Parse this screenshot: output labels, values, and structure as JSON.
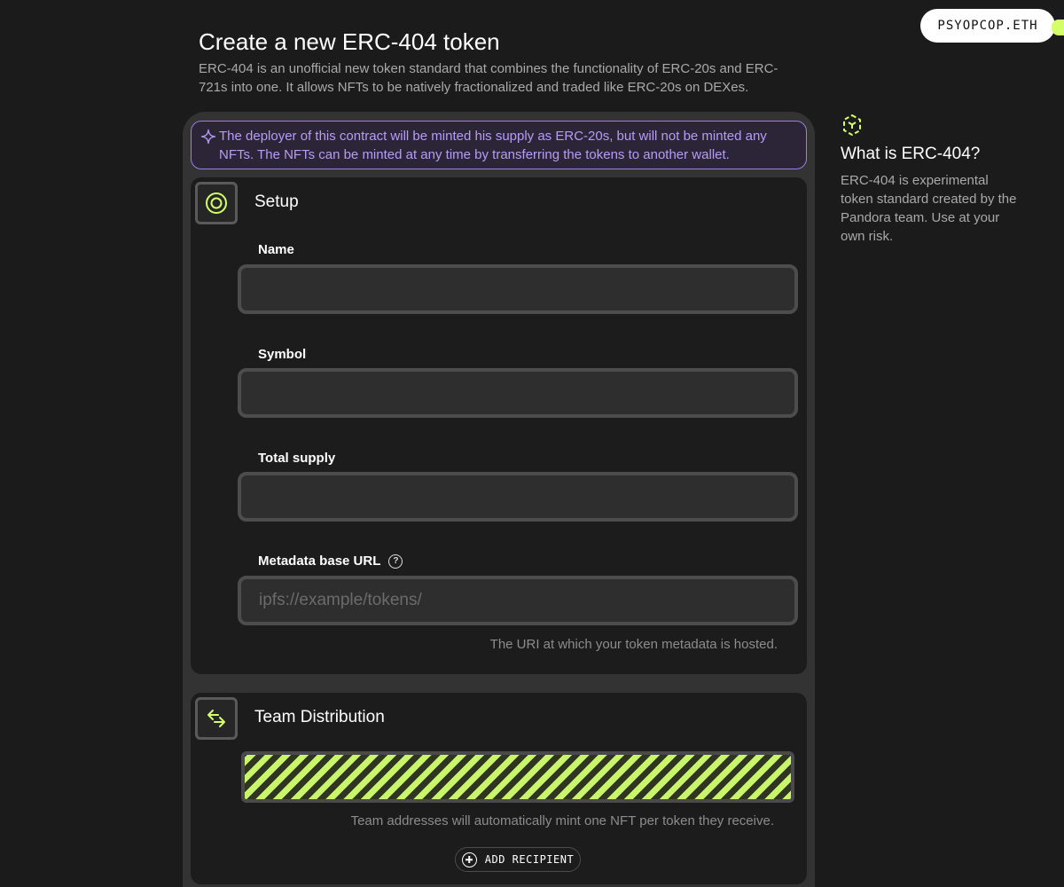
{
  "wallet": {
    "label": "PSYOPCOP.ETH"
  },
  "header": {
    "title": "Create a new ERC-404 token",
    "description": "ERC-404 is an unofficial new token standard that combines the functionality of ERC-20s and ERC-721s into one. It allows NFTs to be natively fractionalized and traded like ERC-20s on DEXes."
  },
  "banner": {
    "text": "The deployer of this contract will be minted his supply as ERC-20s, but will not be minted any NFTs. The NFTs can be minted at any time by transferring the tokens to another wallet.",
    "icon": "sparkle-icon"
  },
  "setup": {
    "title": "Setup",
    "icon": "target-icon",
    "fields": {
      "name": {
        "label": "Name",
        "value": "",
        "placeholder": ""
      },
      "symbol": {
        "label": "Symbol",
        "value": "",
        "placeholder": ""
      },
      "total_supply": {
        "label": "Total supply",
        "value": "",
        "placeholder": ""
      },
      "metadata": {
        "label": "Metadata base URL",
        "value": "",
        "placeholder": "ipfs://example/tokens/",
        "hint": "The URI at which your token metadata is hosted.",
        "help_icon": "question-icon",
        "help_glyph": "?"
      }
    }
  },
  "team": {
    "title": "Team Distribution",
    "icon": "transfer-arrows-icon",
    "hint": "Team addresses will automatically mint one NFT per token they receive.",
    "add_label": "ADD RECIPIENT"
  },
  "aside": {
    "icon": "cube-logo-icon",
    "title": "What is ERC-404?",
    "text": "ERC-404 is experimental token standard created by the Pandora team. Use at your own risk."
  },
  "colors": {
    "background": "#1b1b1b",
    "accent_lime": "#d4ff6a",
    "banner_purple": "#9b7fe6",
    "card": "#333333",
    "section": "#1c1c1c"
  }
}
